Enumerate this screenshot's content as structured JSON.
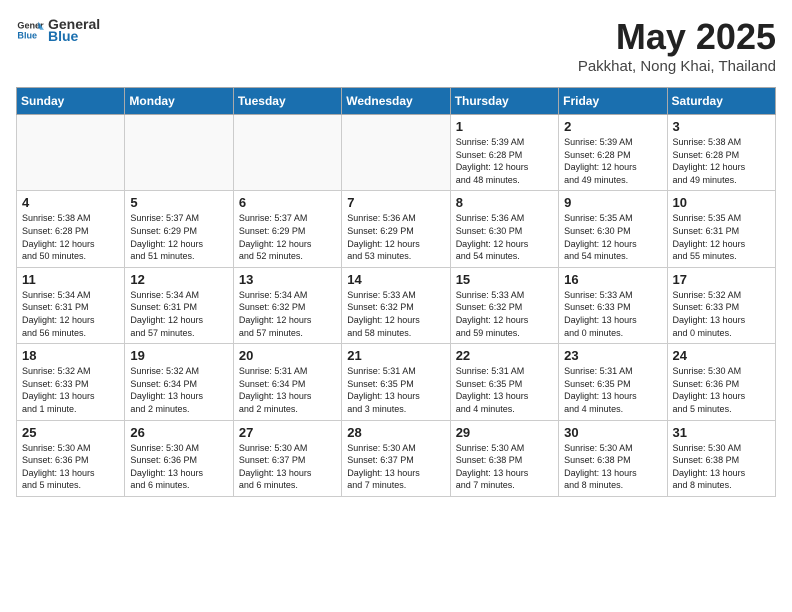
{
  "header": {
    "logo_general": "General",
    "logo_blue": "Blue",
    "month_year": "May 2025",
    "location": "Pakkhat, Nong Khai, Thailand"
  },
  "days_of_week": [
    "Sunday",
    "Monday",
    "Tuesday",
    "Wednesday",
    "Thursday",
    "Friday",
    "Saturday"
  ],
  "weeks": [
    [
      {
        "day": "",
        "info": ""
      },
      {
        "day": "",
        "info": ""
      },
      {
        "day": "",
        "info": ""
      },
      {
        "day": "",
        "info": ""
      },
      {
        "day": "1",
        "info": "Sunrise: 5:39 AM\nSunset: 6:28 PM\nDaylight: 12 hours\nand 48 minutes."
      },
      {
        "day": "2",
        "info": "Sunrise: 5:39 AM\nSunset: 6:28 PM\nDaylight: 12 hours\nand 49 minutes."
      },
      {
        "day": "3",
        "info": "Sunrise: 5:38 AM\nSunset: 6:28 PM\nDaylight: 12 hours\nand 49 minutes."
      }
    ],
    [
      {
        "day": "4",
        "info": "Sunrise: 5:38 AM\nSunset: 6:28 PM\nDaylight: 12 hours\nand 50 minutes."
      },
      {
        "day": "5",
        "info": "Sunrise: 5:37 AM\nSunset: 6:29 PM\nDaylight: 12 hours\nand 51 minutes."
      },
      {
        "day": "6",
        "info": "Sunrise: 5:37 AM\nSunset: 6:29 PM\nDaylight: 12 hours\nand 52 minutes."
      },
      {
        "day": "7",
        "info": "Sunrise: 5:36 AM\nSunset: 6:29 PM\nDaylight: 12 hours\nand 53 minutes."
      },
      {
        "day": "8",
        "info": "Sunrise: 5:36 AM\nSunset: 6:30 PM\nDaylight: 12 hours\nand 54 minutes."
      },
      {
        "day": "9",
        "info": "Sunrise: 5:35 AM\nSunset: 6:30 PM\nDaylight: 12 hours\nand 54 minutes."
      },
      {
        "day": "10",
        "info": "Sunrise: 5:35 AM\nSunset: 6:31 PM\nDaylight: 12 hours\nand 55 minutes."
      }
    ],
    [
      {
        "day": "11",
        "info": "Sunrise: 5:34 AM\nSunset: 6:31 PM\nDaylight: 12 hours\nand 56 minutes."
      },
      {
        "day": "12",
        "info": "Sunrise: 5:34 AM\nSunset: 6:31 PM\nDaylight: 12 hours\nand 57 minutes."
      },
      {
        "day": "13",
        "info": "Sunrise: 5:34 AM\nSunset: 6:32 PM\nDaylight: 12 hours\nand 57 minutes."
      },
      {
        "day": "14",
        "info": "Sunrise: 5:33 AM\nSunset: 6:32 PM\nDaylight: 12 hours\nand 58 minutes."
      },
      {
        "day": "15",
        "info": "Sunrise: 5:33 AM\nSunset: 6:32 PM\nDaylight: 12 hours\nand 59 minutes."
      },
      {
        "day": "16",
        "info": "Sunrise: 5:33 AM\nSunset: 6:33 PM\nDaylight: 13 hours\nand 0 minutes."
      },
      {
        "day": "17",
        "info": "Sunrise: 5:32 AM\nSunset: 6:33 PM\nDaylight: 13 hours\nand 0 minutes."
      }
    ],
    [
      {
        "day": "18",
        "info": "Sunrise: 5:32 AM\nSunset: 6:33 PM\nDaylight: 13 hours\nand 1 minute."
      },
      {
        "day": "19",
        "info": "Sunrise: 5:32 AM\nSunset: 6:34 PM\nDaylight: 13 hours\nand 2 minutes."
      },
      {
        "day": "20",
        "info": "Sunrise: 5:31 AM\nSunset: 6:34 PM\nDaylight: 13 hours\nand 2 minutes."
      },
      {
        "day": "21",
        "info": "Sunrise: 5:31 AM\nSunset: 6:35 PM\nDaylight: 13 hours\nand 3 minutes."
      },
      {
        "day": "22",
        "info": "Sunrise: 5:31 AM\nSunset: 6:35 PM\nDaylight: 13 hours\nand 4 minutes."
      },
      {
        "day": "23",
        "info": "Sunrise: 5:31 AM\nSunset: 6:35 PM\nDaylight: 13 hours\nand 4 minutes."
      },
      {
        "day": "24",
        "info": "Sunrise: 5:30 AM\nSunset: 6:36 PM\nDaylight: 13 hours\nand 5 minutes."
      }
    ],
    [
      {
        "day": "25",
        "info": "Sunrise: 5:30 AM\nSunset: 6:36 PM\nDaylight: 13 hours\nand 5 minutes."
      },
      {
        "day": "26",
        "info": "Sunrise: 5:30 AM\nSunset: 6:36 PM\nDaylight: 13 hours\nand 6 minutes."
      },
      {
        "day": "27",
        "info": "Sunrise: 5:30 AM\nSunset: 6:37 PM\nDaylight: 13 hours\nand 6 minutes."
      },
      {
        "day": "28",
        "info": "Sunrise: 5:30 AM\nSunset: 6:37 PM\nDaylight: 13 hours\nand 7 minutes."
      },
      {
        "day": "29",
        "info": "Sunrise: 5:30 AM\nSunset: 6:38 PM\nDaylight: 13 hours\nand 7 minutes."
      },
      {
        "day": "30",
        "info": "Sunrise: 5:30 AM\nSunset: 6:38 PM\nDaylight: 13 hours\nand 8 minutes."
      },
      {
        "day": "31",
        "info": "Sunrise: 5:30 AM\nSunset: 6:38 PM\nDaylight: 13 hours\nand 8 minutes."
      }
    ]
  ]
}
